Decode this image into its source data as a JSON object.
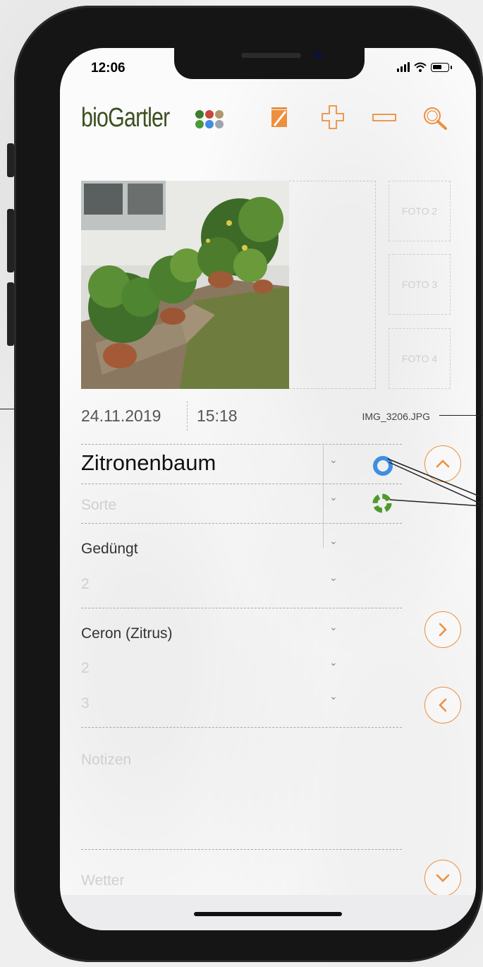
{
  "status_bar": {
    "time": "12:06"
  },
  "app": {
    "logo_prefix": "bio",
    "logo_suffix": "Gartler",
    "toolbar_icons": [
      "edit-icon",
      "plus-icon",
      "minus-icon",
      "search-icon"
    ],
    "accent_color": "#ec8f3e",
    "logo_color": "#3d5020",
    "dot_colors": [
      "#3e7d2c",
      "#c7473a",
      "#b2966c",
      "#4b9b39",
      "#3f8ee0",
      "#9ea5ae"
    ]
  },
  "photos": {
    "slots": [
      "FOTO 2",
      "FOTO 3",
      "FOTO 4"
    ]
  },
  "entry": {
    "date": "24.11.2019",
    "time": "15:18",
    "filename": "IMG_3206.JPG",
    "name": "Zitronenbaum",
    "variety_placeholder": "Sorte",
    "action": "Gedüngt",
    "action_sub": "2",
    "product": "Ceron (Zitrus)",
    "product_sub1": "2",
    "product_sub2": "3",
    "notes_placeholder": "Notizen",
    "weather_placeholder": "Wetter"
  },
  "status_rings": {
    "blue": "#3f8ee0",
    "green": "#4e9a2c"
  }
}
